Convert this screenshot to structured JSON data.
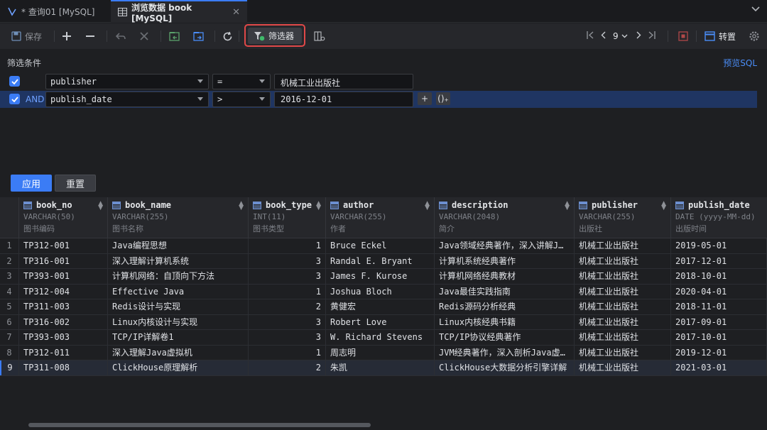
{
  "tabs": [
    {
      "label": "* 查询01 [MySQL]"
    },
    {
      "label": "浏览数据 book [MySQL]"
    }
  ],
  "toolbar": {
    "save_label": "保存",
    "filter_label": "筛选器",
    "page_number": "9",
    "transpose_label": "转置"
  },
  "filter": {
    "title": "筛选条件",
    "preview_sql": "预览SQL",
    "rows": [
      {
        "connector": "",
        "field": "publisher",
        "op": "=",
        "value": "机械工业出版社"
      },
      {
        "connector": "AND",
        "field": "publish_date",
        "op": ">",
        "value": "2016-12-01"
      }
    ],
    "add_label": "+",
    "group_label": "()₊",
    "apply_label": "应用",
    "reset_label": "重置"
  },
  "columns": [
    {
      "name": "book_no",
      "type": "VARCHAR(50)",
      "comment": "图书编码"
    },
    {
      "name": "book_name",
      "type": "VARCHAR(255)",
      "comment": "图书名称"
    },
    {
      "name": "book_type",
      "type": "INT(11)",
      "comment": "图书类型"
    },
    {
      "name": "author",
      "type": "VARCHAR(255)",
      "comment": "作者"
    },
    {
      "name": "description",
      "type": "VARCHAR(2048)",
      "comment": "简介"
    },
    {
      "name": "publisher",
      "type": "VARCHAR(255)",
      "comment": "出版社"
    },
    {
      "name": "publish_date",
      "type": "DATE (yyyy-MM-dd)",
      "comment": "出版时间"
    }
  ],
  "rows": [
    {
      "n": "1",
      "book_no": "TP312-001",
      "book_name": "Java编程思想",
      "book_type": "1",
      "author": "Bruce Eckel",
      "description": "Java领域经典著作，深入讲解J…",
      "publisher": "机械工业出版社",
      "publish_date": "2019-05-01"
    },
    {
      "n": "2",
      "book_no": "TP316-001",
      "book_name": "深入理解计算机系统",
      "book_type": "3",
      "author": "Randal E. Bryant",
      "description": "计算机系统经典著作",
      "publisher": "机械工业出版社",
      "publish_date": "2017-12-01"
    },
    {
      "n": "3",
      "book_no": "TP393-001",
      "book_name": "计算机网络：自顶向下方法",
      "book_type": "3",
      "author": "James F. Kurose",
      "description": "计算机网络经典教材",
      "publisher": "机械工业出版社",
      "publish_date": "2018-10-01"
    },
    {
      "n": "4",
      "book_no": "TP312-004",
      "book_name": "Effective Java",
      "book_type": "1",
      "author": "Joshua Bloch",
      "description": "Java最佳实践指南",
      "publisher": "机械工业出版社",
      "publish_date": "2020-04-01"
    },
    {
      "n": "5",
      "book_no": "TP311-003",
      "book_name": "Redis设计与实现",
      "book_type": "2",
      "author": "黄健宏",
      "description": "Redis源码分析经典",
      "publisher": "机械工业出版社",
      "publish_date": "2018-11-01"
    },
    {
      "n": "6",
      "book_no": "TP316-002",
      "book_name": "Linux内核设计与实现",
      "book_type": "3",
      "author": "Robert Love",
      "description": "Linux内核经典书籍",
      "publisher": "机械工业出版社",
      "publish_date": "2017-09-01"
    },
    {
      "n": "7",
      "book_no": "TP393-003",
      "book_name": "TCP/IP详解卷1",
      "book_type": "3",
      "author": "W. Richard Stevens",
      "description": "TCP/IP协议经典著作",
      "publisher": "机械工业出版社",
      "publish_date": "2017-10-01"
    },
    {
      "n": "8",
      "book_no": "TP312-011",
      "book_name": "深入理解Java虚拟机",
      "book_type": "1",
      "author": "周志明",
      "description": "JVM经典著作，深入剖析Java虚…",
      "publisher": "机械工业出版社",
      "publish_date": "2019-12-01"
    },
    {
      "n": "9",
      "book_no": "TP311-008",
      "book_name": "ClickHouse原理解析",
      "book_type": "2",
      "author": "朱凯",
      "description": "ClickHouse大数据分析引擎详解",
      "publisher": "机械工业出版社",
      "publish_date": "2021-03-01"
    }
  ]
}
